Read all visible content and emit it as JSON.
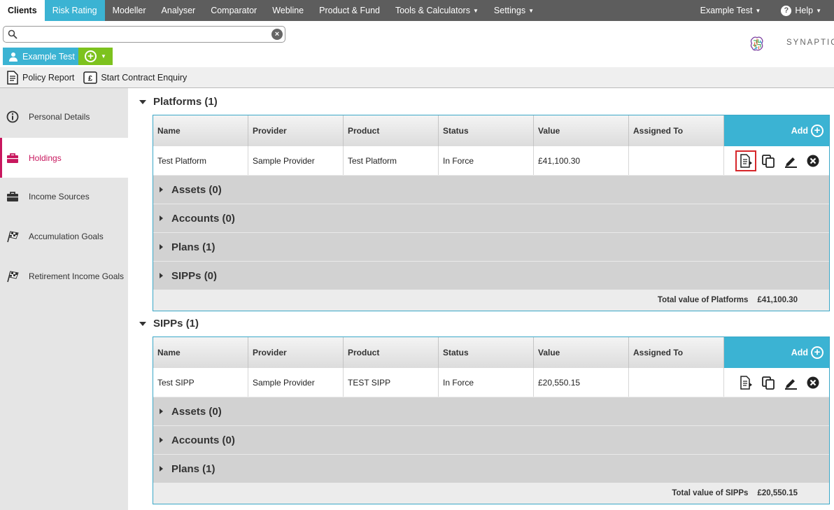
{
  "topnav": {
    "items": [
      "Clients",
      "Risk Rating",
      "Modeller",
      "Analyser",
      "Comparator",
      "Webline",
      "Product & Fund",
      "Tools & Calculators",
      "Settings"
    ],
    "user": "Example Test",
    "help": "Help"
  },
  "search": {
    "value": "",
    "placeholder": ""
  },
  "client": {
    "name": "Example Test"
  },
  "logo": {
    "text": "SYNAPTIC"
  },
  "toolbar": {
    "policy_report": "Policy Report",
    "start_contract_enquiry": "Start Contract Enquiry"
  },
  "sidebar": {
    "items": [
      {
        "label": "Personal Details"
      },
      {
        "label": "Holdings"
      },
      {
        "label": "Income Sources"
      },
      {
        "label": "Accumulation Goals"
      },
      {
        "label": "Retirement Income Goals"
      }
    ]
  },
  "columns": [
    "Name",
    "Provider",
    "Product",
    "Status",
    "Value",
    "Assigned To"
  ],
  "add_label": "Add",
  "platforms": {
    "title": "Platforms (1)",
    "row": {
      "name": "Test Platform",
      "provider": "Sample Provider",
      "product": "Test Platform",
      "status": "In Force",
      "value": "£41,100.30",
      "assigned_to": ""
    },
    "subsections": [
      "Assets (0)",
      "Accounts (0)",
      "Plans (1)",
      "SIPPs (0)"
    ],
    "total_label": "Total value of Platforms",
    "total_value": "£41,100.30"
  },
  "sipps": {
    "title": "SIPPs (1)",
    "row": {
      "name": "Test SIPP",
      "provider": "Sample Provider",
      "product": "TEST SIPP",
      "status": "In Force",
      "value": "£20,550.15",
      "assigned_to": ""
    },
    "subsections": [
      "Assets (0)",
      "Accounts (0)",
      "Plans (1)"
    ],
    "total_label": "Total value of SIPPs",
    "total_value": "£20,550.15"
  },
  "colors": {
    "accent": "#3bb3d3",
    "nav": "#5d5d5d",
    "active_side": "#c8175e",
    "add_green": "#7dc21e",
    "highlight": "#d6262a"
  }
}
